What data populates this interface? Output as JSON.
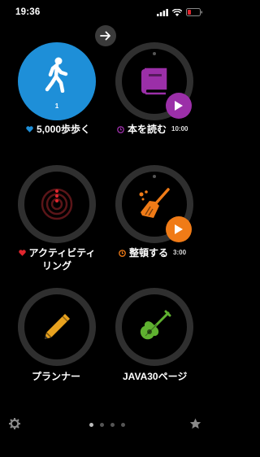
{
  "status_bar": {
    "time": "19:36"
  },
  "tiles": [
    {
      "name": "walk",
      "label": "5,000歩歩く",
      "count": "1",
      "color": "#1e8fd8"
    },
    {
      "name": "read-book",
      "label": "本を読む",
      "time": "10:00",
      "color": "#9b2fa8"
    },
    {
      "name": "activity",
      "label_line1": "アクティビティ",
      "label_line2": "リング",
      "color": "#e0262e"
    },
    {
      "name": "tidy-up",
      "label": "整頓する",
      "time": "3:00",
      "color": "#f07b17"
    },
    {
      "name": "planner",
      "label": "プランナー",
      "color": "#e8a21f"
    },
    {
      "name": "java",
      "label": "JAVA30ページ",
      "color": "#5fb130"
    }
  ],
  "pager": {
    "pages": 4,
    "active": 0
  },
  "icons": [
    "arrow-right-icon",
    "walking-person-icon",
    "book-icon",
    "play-icon",
    "radar-icon",
    "broom-icon",
    "pencil-icon",
    "guitar-icon",
    "gear-icon",
    "star-icon",
    "heart-icon",
    "timer-icon"
  ]
}
